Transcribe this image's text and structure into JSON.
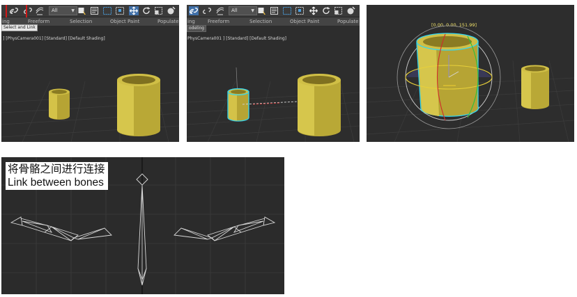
{
  "panel1": {
    "dropdown_value": "All",
    "ribbon_tabs": [
      "ing",
      "Freeform",
      "Selection",
      "Object Paint",
      "Populate"
    ],
    "tooltip": "Select and Link",
    "viewport_label": "] [PhysCamera001] [Standard] [Default Shading]"
  },
  "panel2": {
    "dropdown_value": "All",
    "ribbon_tabs": [
      "ing",
      "Freeform",
      "Selection",
      "Object Paint",
      "Populate"
    ],
    "tab_fragment": "odeling",
    "viewport_label": "PhysCamera001 ] [Standard] [Default Shading]"
  },
  "panel3": {
    "transform_readout": "[0.00, 0.00, 151.99]"
  },
  "panel4": {
    "caption_cn": "将骨骼之间进行连接",
    "caption_en": "Link between bones"
  },
  "colors": {
    "viewport_bg": "#2d2d2d",
    "cylinder": "#c7b53c",
    "selection": "#33d6f0",
    "highlight": "#d01818",
    "bone": "#dadada"
  },
  "icons": [
    "link-icon",
    "unlink-icon",
    "bind-spacewarp-icon",
    "select-object-icon",
    "select-by-name-icon",
    "rect-select-icon",
    "window-crossing-icon",
    "move-icon",
    "rotate-icon",
    "scale-icon",
    "placement-icon"
  ]
}
